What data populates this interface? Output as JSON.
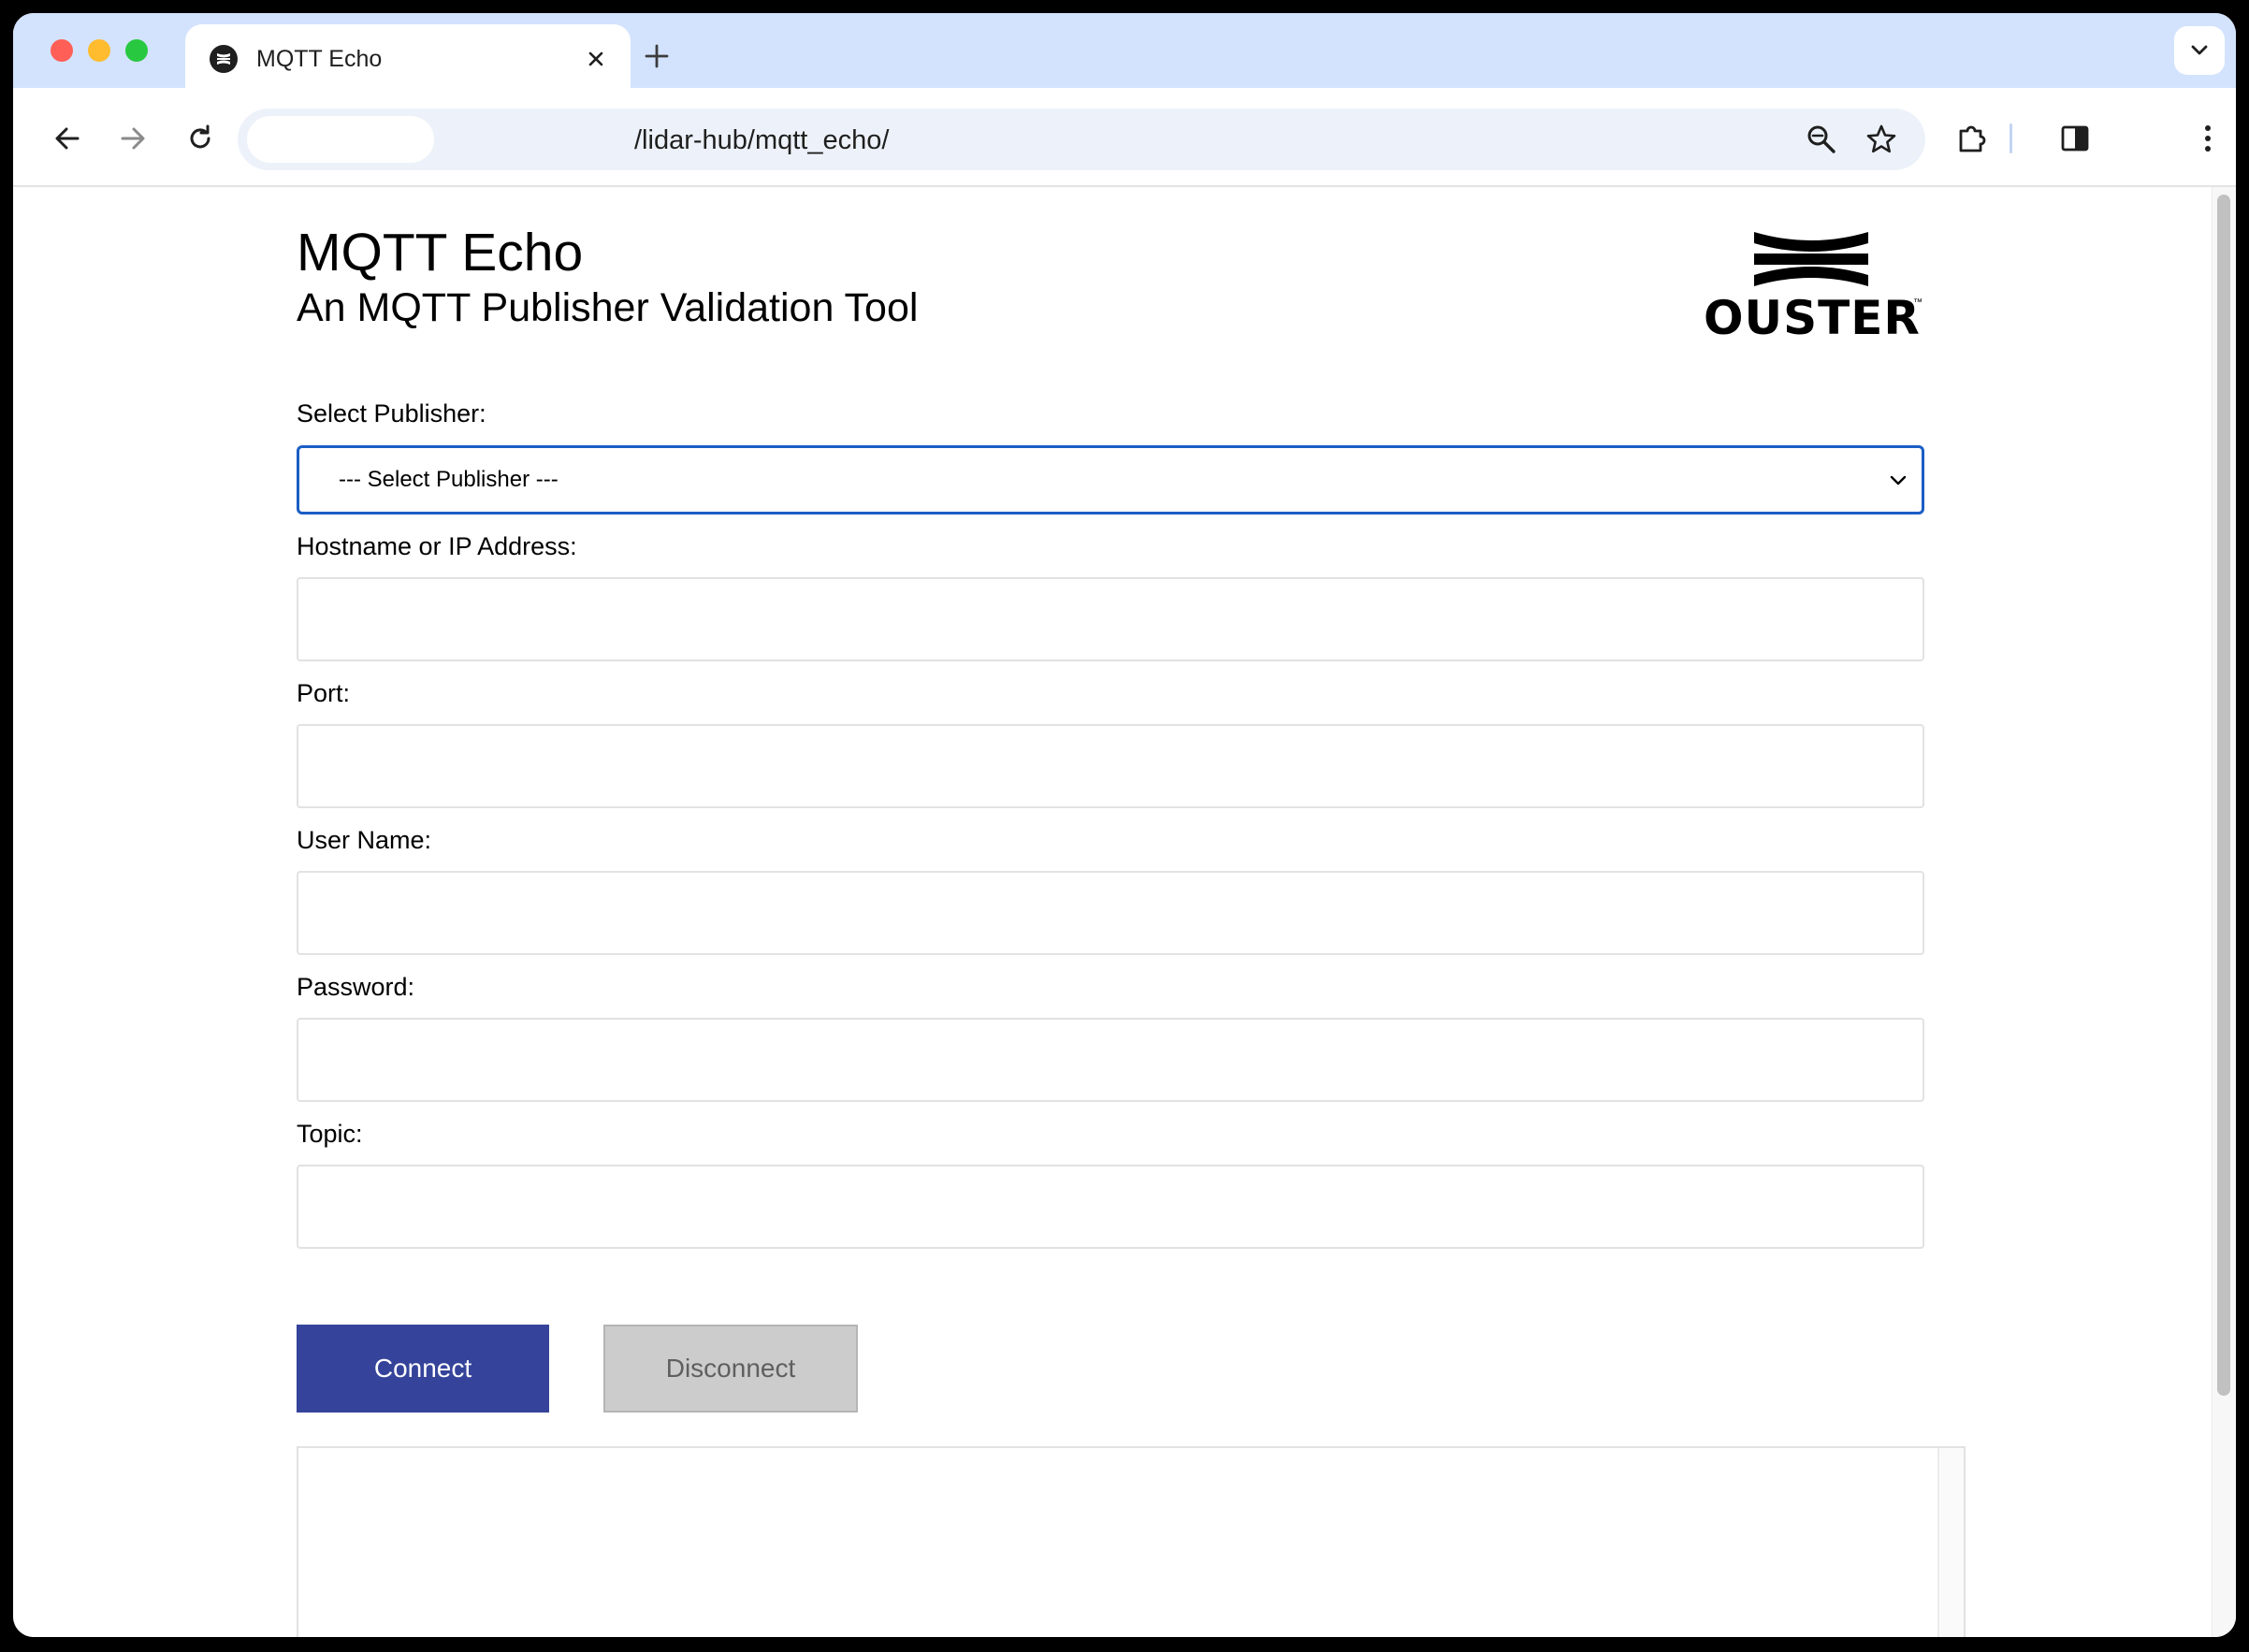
{
  "browser": {
    "tab": {
      "title": "MQTT Echo",
      "favicon": "ouster-favicon-icon"
    },
    "address_bar": {
      "url": "/lidar-hub/mqtt_echo/"
    },
    "colors": {
      "tabstrip_bg": "#d3e3fd",
      "omnibox_bg": "#edf2fa"
    }
  },
  "page": {
    "title": "MQTT Echo",
    "subtitle": "An MQTT Publisher Validation Tool",
    "logo_text": "OUSTER",
    "logo_tm": "™"
  },
  "form": {
    "publisher": {
      "label": "Select Publisher:",
      "selected": "--- Select Publisher ---"
    },
    "hostname": {
      "label": "Hostname or IP Address:",
      "value": ""
    },
    "port": {
      "label": "Port:",
      "value": ""
    },
    "username": {
      "label": "User Name:",
      "value": ""
    },
    "password": {
      "label": "Password:",
      "value": ""
    },
    "topic": {
      "label": "Topic:",
      "value": ""
    }
  },
  "actions": {
    "connect_label": "Connect",
    "disconnect_label": "Disconnect",
    "colors": {
      "connect_bg": "#35449a",
      "disconnect_bg": "#cccccc",
      "select_focus_border": "#1b5dc5"
    }
  }
}
